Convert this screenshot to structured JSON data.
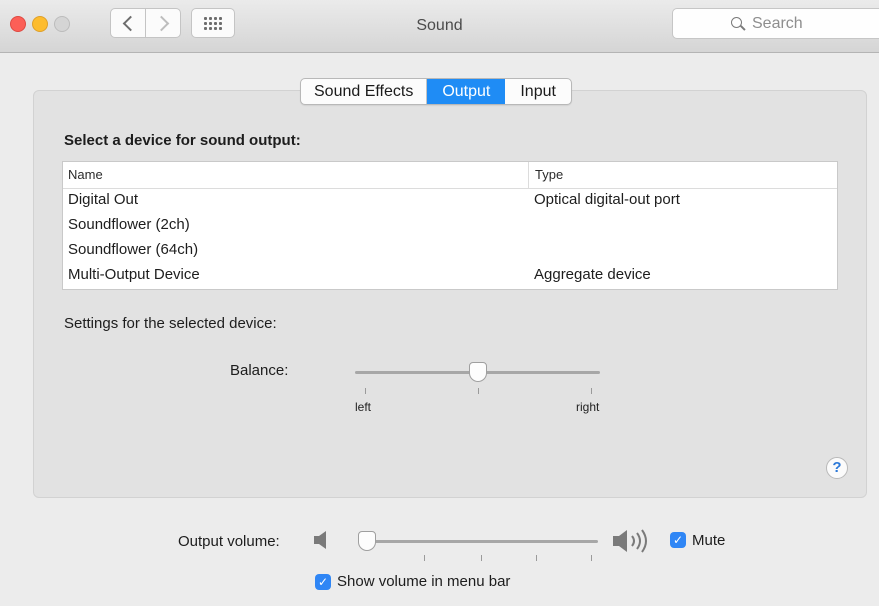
{
  "window": {
    "title": "Sound"
  },
  "search": {
    "placeholder": "Search"
  },
  "tabs": [
    {
      "label": "Sound Effects",
      "active": false
    },
    {
      "label": "Output",
      "active": true
    },
    {
      "label": "Input",
      "active": false
    }
  ],
  "output": {
    "heading": "Select a device for sound output:",
    "columns": {
      "name": "Name",
      "type": "Type"
    },
    "devices": [
      {
        "name": "Digital Out",
        "type": "Optical digital-out port"
      },
      {
        "name": "Soundflower (2ch)",
        "type": ""
      },
      {
        "name": "Soundflower (64ch)",
        "type": ""
      },
      {
        "name": "Multi-Output Device",
        "type": "Aggregate device"
      }
    ],
    "settings_label": "Settings for the selected device:",
    "balance": {
      "label": "Balance:",
      "left_label": "left",
      "right_label": "right",
      "value": 0.5
    }
  },
  "help": {
    "glyph": "?"
  },
  "volume": {
    "label": "Output volume:",
    "level": 0.0,
    "mute_label": "Mute",
    "mute_checked": true,
    "show_in_menubar_label": "Show volume in menu bar",
    "show_in_menubar_checked": true
  },
  "colors": {
    "accent": "#1f8cf5",
    "checkbox": "#2f86f5"
  }
}
